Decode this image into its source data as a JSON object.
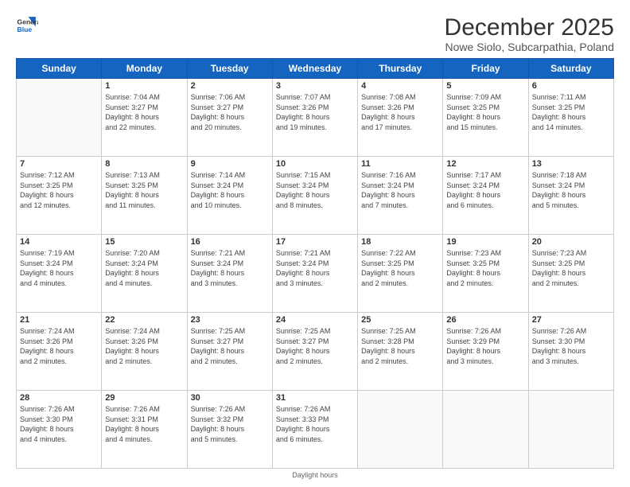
{
  "logo": {
    "line1": "General",
    "line2": "Blue"
  },
  "title": "December 2025",
  "location": "Nowe Siolo, Subcarpathia, Poland",
  "days_of_week": [
    "Sunday",
    "Monday",
    "Tuesday",
    "Wednesday",
    "Thursday",
    "Friday",
    "Saturday"
  ],
  "footer": "Daylight hours",
  "weeks": [
    [
      {
        "num": "",
        "info": ""
      },
      {
        "num": "1",
        "info": "Sunrise: 7:04 AM\nSunset: 3:27 PM\nDaylight: 8 hours\nand 22 minutes."
      },
      {
        "num": "2",
        "info": "Sunrise: 7:06 AM\nSunset: 3:27 PM\nDaylight: 8 hours\nand 20 minutes."
      },
      {
        "num": "3",
        "info": "Sunrise: 7:07 AM\nSunset: 3:26 PM\nDaylight: 8 hours\nand 19 minutes."
      },
      {
        "num": "4",
        "info": "Sunrise: 7:08 AM\nSunset: 3:26 PM\nDaylight: 8 hours\nand 17 minutes."
      },
      {
        "num": "5",
        "info": "Sunrise: 7:09 AM\nSunset: 3:25 PM\nDaylight: 8 hours\nand 15 minutes."
      },
      {
        "num": "6",
        "info": "Sunrise: 7:11 AM\nSunset: 3:25 PM\nDaylight: 8 hours\nand 14 minutes."
      }
    ],
    [
      {
        "num": "7",
        "info": "Sunrise: 7:12 AM\nSunset: 3:25 PM\nDaylight: 8 hours\nand 12 minutes."
      },
      {
        "num": "8",
        "info": "Sunrise: 7:13 AM\nSunset: 3:25 PM\nDaylight: 8 hours\nand 11 minutes."
      },
      {
        "num": "9",
        "info": "Sunrise: 7:14 AM\nSunset: 3:24 PM\nDaylight: 8 hours\nand 10 minutes."
      },
      {
        "num": "10",
        "info": "Sunrise: 7:15 AM\nSunset: 3:24 PM\nDaylight: 8 hours\nand 8 minutes."
      },
      {
        "num": "11",
        "info": "Sunrise: 7:16 AM\nSunset: 3:24 PM\nDaylight: 8 hours\nand 7 minutes."
      },
      {
        "num": "12",
        "info": "Sunrise: 7:17 AM\nSunset: 3:24 PM\nDaylight: 8 hours\nand 6 minutes."
      },
      {
        "num": "13",
        "info": "Sunrise: 7:18 AM\nSunset: 3:24 PM\nDaylight: 8 hours\nand 5 minutes."
      }
    ],
    [
      {
        "num": "14",
        "info": "Sunrise: 7:19 AM\nSunset: 3:24 PM\nDaylight: 8 hours\nand 4 minutes."
      },
      {
        "num": "15",
        "info": "Sunrise: 7:20 AM\nSunset: 3:24 PM\nDaylight: 8 hours\nand 4 minutes."
      },
      {
        "num": "16",
        "info": "Sunrise: 7:21 AM\nSunset: 3:24 PM\nDaylight: 8 hours\nand 3 minutes."
      },
      {
        "num": "17",
        "info": "Sunrise: 7:21 AM\nSunset: 3:24 PM\nDaylight: 8 hours\nand 3 minutes."
      },
      {
        "num": "18",
        "info": "Sunrise: 7:22 AM\nSunset: 3:25 PM\nDaylight: 8 hours\nand 2 minutes."
      },
      {
        "num": "19",
        "info": "Sunrise: 7:23 AM\nSunset: 3:25 PM\nDaylight: 8 hours\nand 2 minutes."
      },
      {
        "num": "20",
        "info": "Sunrise: 7:23 AM\nSunset: 3:25 PM\nDaylight: 8 hours\nand 2 minutes."
      }
    ],
    [
      {
        "num": "21",
        "info": "Sunrise: 7:24 AM\nSunset: 3:26 PM\nDaylight: 8 hours\nand 2 minutes."
      },
      {
        "num": "22",
        "info": "Sunrise: 7:24 AM\nSunset: 3:26 PM\nDaylight: 8 hours\nand 2 minutes."
      },
      {
        "num": "23",
        "info": "Sunrise: 7:25 AM\nSunset: 3:27 PM\nDaylight: 8 hours\nand 2 minutes."
      },
      {
        "num": "24",
        "info": "Sunrise: 7:25 AM\nSunset: 3:27 PM\nDaylight: 8 hours\nand 2 minutes."
      },
      {
        "num": "25",
        "info": "Sunrise: 7:25 AM\nSunset: 3:28 PM\nDaylight: 8 hours\nand 2 minutes."
      },
      {
        "num": "26",
        "info": "Sunrise: 7:26 AM\nSunset: 3:29 PM\nDaylight: 8 hours\nand 3 minutes."
      },
      {
        "num": "27",
        "info": "Sunrise: 7:26 AM\nSunset: 3:30 PM\nDaylight: 8 hours\nand 3 minutes."
      }
    ],
    [
      {
        "num": "28",
        "info": "Sunrise: 7:26 AM\nSunset: 3:30 PM\nDaylight: 8 hours\nand 4 minutes."
      },
      {
        "num": "29",
        "info": "Sunrise: 7:26 AM\nSunset: 3:31 PM\nDaylight: 8 hours\nand 4 minutes."
      },
      {
        "num": "30",
        "info": "Sunrise: 7:26 AM\nSunset: 3:32 PM\nDaylight: 8 hours\nand 5 minutes."
      },
      {
        "num": "31",
        "info": "Sunrise: 7:26 AM\nSunset: 3:33 PM\nDaylight: 8 hours\nand 6 minutes."
      },
      {
        "num": "",
        "info": ""
      },
      {
        "num": "",
        "info": ""
      },
      {
        "num": "",
        "info": ""
      }
    ]
  ]
}
